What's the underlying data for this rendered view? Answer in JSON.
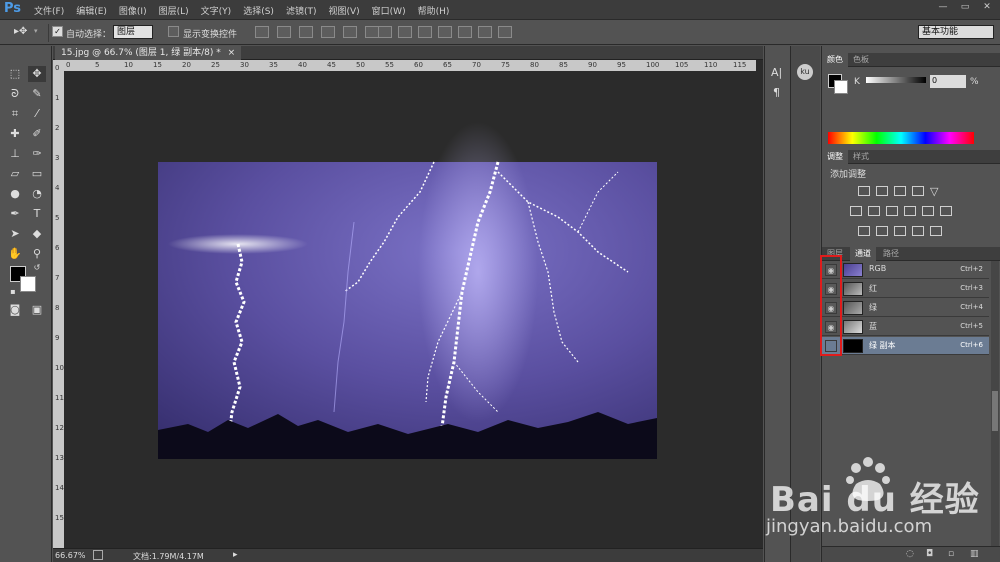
{
  "app": {
    "logo": "Ps",
    "win_min": "—",
    "win_restore": "▭",
    "win_close": "✕"
  },
  "menu": [
    "文件(F)",
    "编辑(E)",
    "图像(I)",
    "图层(L)",
    "文字(Y)",
    "选择(S)",
    "滤镜(T)",
    "视图(V)",
    "窗口(W)",
    "帮助(H)"
  ],
  "options": {
    "auto_select_label": "自动选择：",
    "auto_select_value": "图层",
    "show_transform_label": "显示变换控件",
    "workspace": "基本功能"
  },
  "document": {
    "tab_title": "15.jpg @ 66.7% (图层 1, 绿 副本/8) *",
    "tab_close": "×"
  },
  "ruler": {
    "h": [
      "0",
      "5",
      "10",
      "15",
      "20",
      "25",
      "30",
      "35",
      "40",
      "45",
      "50",
      "55",
      "60",
      "65",
      "70",
      "75",
      "80",
      "85",
      "90",
      "95",
      "100",
      "105",
      "110",
      "115"
    ],
    "v": [
      "0",
      "1",
      "2",
      "3",
      "4",
      "5",
      "6",
      "7",
      "8",
      "9",
      "10",
      "11",
      "12",
      "13",
      "14",
      "15"
    ]
  },
  "status": {
    "zoom": "66.67%",
    "doc": "文档:1.79M/4.17M"
  },
  "color_panel": {
    "tab_color": "颜色",
    "tab_swatches": "色板",
    "channel": "K",
    "value": "0",
    "unit": "%"
  },
  "adjust_panel": {
    "tab_adjust": "调整",
    "tab_style": "样式",
    "add_label": "添加调整"
  },
  "channels_panel": {
    "tab_layers": "图层",
    "tab_channels": "通道",
    "tab_paths": "路径",
    "rows": [
      {
        "name": "RGB",
        "key": "Ctrl+2"
      },
      {
        "name": "红",
        "key": "Ctrl+3"
      },
      {
        "name": "绿",
        "key": "Ctrl+4"
      },
      {
        "name": "蓝",
        "key": "Ctrl+5"
      },
      {
        "name": "绿 副本",
        "key": "Ctrl+6"
      }
    ]
  },
  "watermark": {
    "brand": "Bai du 经验",
    "url": "jingyan.baidu.com"
  },
  "colors": {
    "accent": "#4d9be6",
    "highlight": "#e01c1c",
    "sky": "#5a4fa0"
  }
}
